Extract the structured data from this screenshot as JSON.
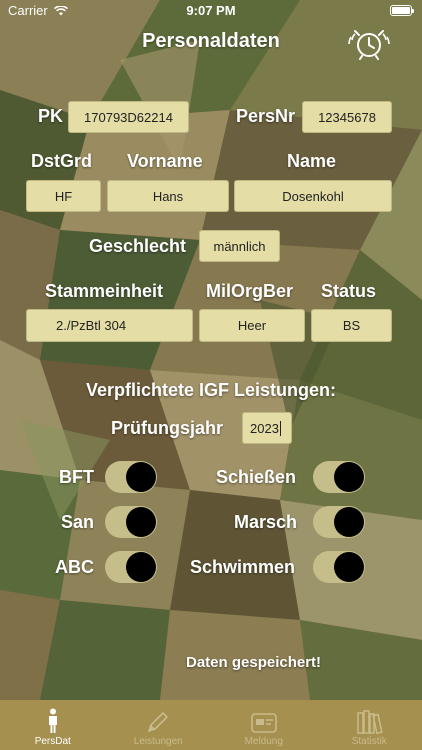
{
  "status_bar": {
    "carrier": "Carrier",
    "time": "9:07 PM"
  },
  "header": {
    "title": "Personaldaten",
    "alarm_icon": "alarm-clock-icon"
  },
  "form": {
    "pk_label": "PK",
    "pk_value": "170793D62214",
    "persnr_label": "PersNr",
    "persnr_value": "12345678",
    "dstgrd_label": "DstGrd",
    "dstgrd_value": "HF",
    "vorname_label": "Vorname",
    "vorname_value": "Hans",
    "name_label": "Name",
    "name_value": "Dosenkohl",
    "geschlecht_label": "Geschlecht",
    "geschlecht_value": "männlich",
    "stammeinheit_label": "Stammeinheit",
    "stammeinheit_value": "2./PzBtl 304",
    "milorgber_label": "MilOrgBer",
    "milorgber_value": "Heer",
    "status_label": "Status",
    "status_value": "BS"
  },
  "igf": {
    "heading": "Verpflichtete IGF Leistungen:",
    "year_label": "Prüfungsjahr",
    "year_value": "2023",
    "switches": [
      {
        "label": "BFT",
        "on": true
      },
      {
        "label": "Schießen",
        "on": true
      },
      {
        "label": "San",
        "on": true
      },
      {
        "label": "Marsch",
        "on": true
      },
      {
        "label": "ABC",
        "on": true
      },
      {
        "label": "Schwimmen",
        "on": true
      }
    ]
  },
  "save_message": "Daten gespeichert!",
  "tabs": [
    {
      "label": "PersDat",
      "icon": "person-icon",
      "active": true
    },
    {
      "label": "Leistungen",
      "icon": "pencil-icon",
      "active": false
    },
    {
      "label": "Meldung",
      "icon": "id-card-icon",
      "active": false
    },
    {
      "label": "Statistik",
      "icon": "books-icon",
      "active": false
    }
  ],
  "colors": {
    "field_bg": "#e4dea6",
    "tab_bar": "#a5904f",
    "toggle_track": "#c5be8a"
  }
}
